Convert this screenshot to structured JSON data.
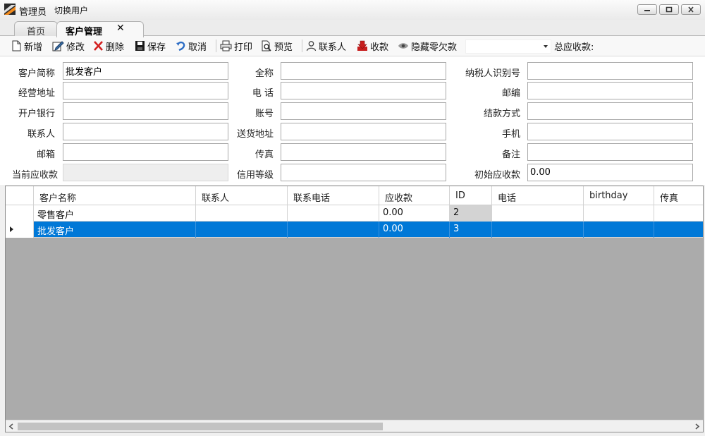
{
  "window": {
    "title": "管理员",
    "switch_user": "切换用户"
  },
  "tabs": [
    {
      "label": "首页"
    },
    {
      "label": "客户管理",
      "close": "✕"
    }
  ],
  "toolbar": {
    "new": "新增",
    "edit": "修改",
    "delete": "删除",
    "save": "保存",
    "cancel": "取消",
    "print": "打印",
    "preview": "预览",
    "contacts": "联系人",
    "receive": "收款",
    "hide_zero": "隐藏零欠款",
    "combo_value": "",
    "total_label": "总应收款:"
  },
  "form": {
    "short_name": {
      "label": "客户简称",
      "value": "批发客户"
    },
    "full_name": {
      "label": "全称",
      "value": ""
    },
    "tax_id": {
      "label": "纳税人识别号",
      "value": ""
    },
    "address": {
      "label": "经营地址",
      "value": ""
    },
    "phone": {
      "label": "电 话",
      "value": ""
    },
    "postcode": {
      "label": "邮编",
      "value": ""
    },
    "bank": {
      "label": "开户银行",
      "value": ""
    },
    "account": {
      "label": "账号",
      "value": ""
    },
    "settlement": {
      "label": "结款方式",
      "value": ""
    },
    "contact": {
      "label": "联系人",
      "value": ""
    },
    "delivery": {
      "label": "送货地址",
      "value": ""
    },
    "mobile": {
      "label": "手机",
      "value": ""
    },
    "email": {
      "label": "邮箱",
      "value": ""
    },
    "fax": {
      "label": "传真",
      "value": ""
    },
    "note": {
      "label": "备注",
      "value": ""
    },
    "current_receivable": {
      "label": "当前应收款",
      "value": ""
    },
    "credit": {
      "label": "信用等级",
      "value": ""
    },
    "initial_receivable": {
      "label": "初始应收款",
      "value": "0.00"
    }
  },
  "grid": {
    "columns": [
      "客户名称",
      "联系人",
      "联系电话",
      "应收款",
      "ID",
      "电话",
      "birthday",
      "传真"
    ],
    "rows": [
      {
        "name": "零售客户",
        "contact": "",
        "contact_phone": "",
        "receivable": "0.00",
        "id": "2",
        "phone": "",
        "birthday": "",
        "fax": ""
      },
      {
        "name": "批发客户",
        "contact": "",
        "contact_phone": "",
        "receivable": "0.00",
        "id": "3",
        "phone": "",
        "birthday": "",
        "fax": "",
        "selected": true
      }
    ]
  },
  "colors": {
    "selection": "#0078d7",
    "grid_background": "#ababab"
  }
}
